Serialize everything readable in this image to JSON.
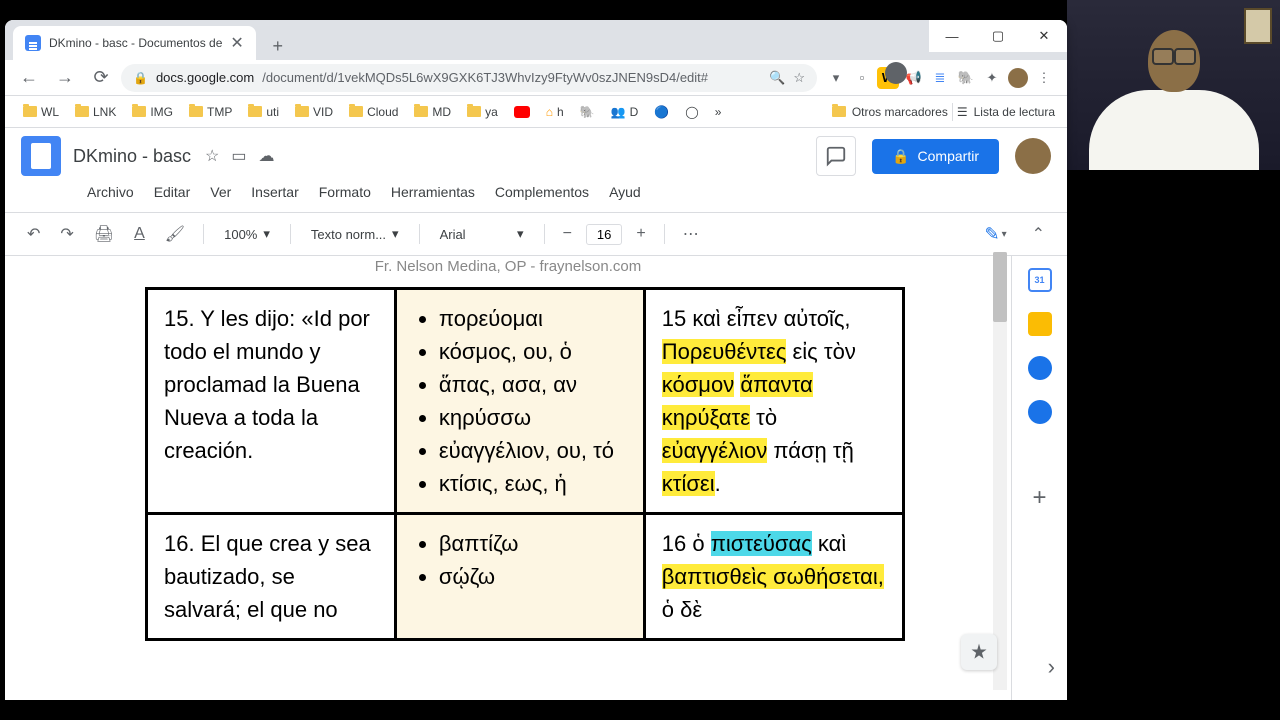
{
  "window": {
    "minimize": "—",
    "maximize": "▢",
    "close": "✕"
  },
  "tab": {
    "title": "DKmino - basc - Documentos de",
    "close": "✕",
    "new": "+"
  },
  "url": {
    "lock": "🔒",
    "host": "docs.google.com",
    "path": "/document/d/1vekMQDs5L6wX9GXK6TJ3WhvIzy9FtyWv0szJNEN9sD4/edit#"
  },
  "nav": {
    "back": "←",
    "forward": "→",
    "reload": "⟳"
  },
  "url_icons": {
    "search": "🔍",
    "star": "☆",
    "pocket": "⬚",
    "shield": "🛡",
    "more": "⋮"
  },
  "bookmarks": {
    "items": [
      "WL",
      "LNK",
      "IMG",
      "TMP",
      "uti",
      "VID",
      "Cloud",
      "MD",
      "ya"
    ],
    "overflow": "»",
    "right1": "Otros marcadores",
    "right2": "Lista de lectura",
    "list_icon": "☰"
  },
  "docs": {
    "title": "DKmino - basc",
    "star": "☆",
    "move": "▭",
    "cloud": "☁",
    "menu": [
      "Archivo",
      "Editar",
      "Ver",
      "Insertar",
      "Formato",
      "Herramientas",
      "Complementos",
      "Ayud"
    ],
    "share": "Compartir",
    "share_icon": "👤"
  },
  "toolbar": {
    "undo": "↶",
    "redo": "↷",
    "print": "🖨",
    "spell": "A",
    "format": "🖌",
    "zoom": "100%",
    "style": "Texto norm...",
    "font": "Arial",
    "size": "16",
    "minus": "−",
    "plus": "+",
    "more": "⋯",
    "caret": "▾",
    "chevron_up": "⌃"
  },
  "subtitle": "Fr. Nelson Medina, OP - fraynelson.com",
  "table": {
    "row15": {
      "left": "15. Y les dijo: «Id por todo el mundo y proclamad la Buena Nueva a toda la creación.",
      "mid": [
        "πορεύομαι",
        "κόσμος, ου, ὁ",
        "ἅπας, ασα, αν",
        "κηρύσσω",
        "εὐαγγέλιον, ου, τό",
        "κτίσις, εως, ἡ"
      ],
      "right_plain1": "15 καὶ εἶπεν αὐτοῖς, ",
      "right_hl1": "Πορευθέντες",
      "right_plain2": " εἰς τὸν ",
      "right_hl2": "κόσμον",
      "right_plain2b": " ",
      "right_hl3": "ἅπαντα κηρύξατε",
      "right_plain3": " τὸ ",
      "right_hl4": "εὐαγγέλιον",
      "right_plain4": " πάσῃ τῇ ",
      "right_hl5": "κτίσει",
      "right_plain5": "."
    },
    "row16": {
      "left": "16. El que crea y sea bautizado, se salvará; el que no",
      "mid": [
        "βαπτίζω",
        "σῴζω"
      ],
      "right_plain1": "16 ὁ ",
      "right_cyan": "πιστεύσας",
      "right_plain2": " καὶ ",
      "right_hl1": "βαπτισθεὶς σωθήσεται,",
      "right_plain3": " ὁ δὲ"
    }
  },
  "side": {
    "plus": "+",
    "chevron": "›"
  }
}
